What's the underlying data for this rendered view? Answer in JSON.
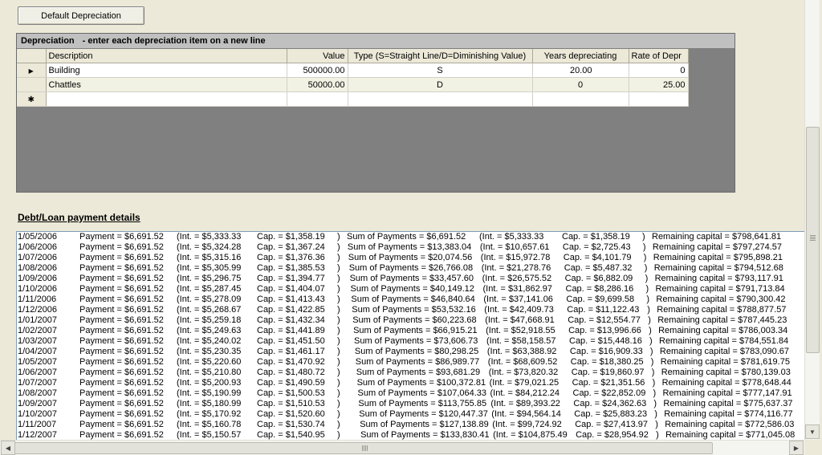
{
  "toolbar": {
    "default_depreciation_label": "Default Depreciation"
  },
  "depreciation": {
    "caption": "Depreciation",
    "hint": "- enter each depreciation item on a new line",
    "columns": [
      "Description",
      "Value",
      "Type (S=Straight  Line/D=Diminishing Value)",
      "Years depreciating",
      "Rate of Depr"
    ],
    "rows": [
      {
        "description": "Building",
        "value": "500000.00",
        "type": "S",
        "years": "20.00",
        "rate": "0"
      },
      {
        "description": "Chattles",
        "value": "50000.00",
        "type": "D",
        "years": "0",
        "rate": "25.00"
      }
    ],
    "current_row_glyph": "▶",
    "new_row_glyph": "✱"
  },
  "loan": {
    "title": "Debt/Loan payment details",
    "rows": [
      [
        "1/05/2006",
        "Payment = $6,691.52",
        "(Int. = $5,333.33",
        "Cap. = $1,358.19",
        ")",
        "Sum of Payments = $6,691.52",
        "(Int. = $5,333.33",
        "Cap. = $1,358.19",
        ")",
        "Remaining capital = $798,641.81"
      ],
      [
        "1/06/2006",
        "Payment = $6,691.52",
        "(Int. = $5,324.28",
        "Cap. = $1,367.24",
        ")",
        "Sum of Payments = $13,383.04",
        "(Int. = $10,657.61",
        "Cap. = $2,725.43",
        ")",
        "Remaining capital = $797,274.57"
      ],
      [
        "1/07/2006",
        "Payment = $6,691.52",
        "(Int. = $5,315.16",
        "Cap. = $1,376.36",
        ")",
        "Sum of Payments = $20,074.56",
        "(Int. = $15,972.78",
        "Cap. = $4,101.79",
        ")",
        "Remaining capital = $795,898.21"
      ],
      [
        "1/08/2006",
        "Payment = $6,691.52",
        "(Int. = $5,305.99",
        "Cap. = $1,385.53",
        ")",
        "Sum of Payments = $26,766.08",
        "(Int. = $21,278.76",
        "Cap. = $5,487.32",
        ")",
        "Remaining capital = $794,512.68"
      ],
      [
        "1/09/2006",
        "Payment = $6,691.52",
        "(Int. = $5,296.75",
        "Cap. = $1,394.77",
        ")",
        "Sum of Payments = $33,457.60",
        "(Int. = $26,575.52",
        "Cap. = $6,882.09",
        ")",
        "Remaining capital = $793,117.91"
      ],
      [
        "1/10/2006",
        "Payment = $6,691.52",
        "(Int. = $5,287.45",
        "Cap. = $1,404.07",
        ")",
        "Sum of Payments = $40,149.12",
        "(Int. = $31,862.97",
        "Cap. = $8,286.16",
        ")",
        "Remaining capital = $791,713.84"
      ],
      [
        "1/11/2006",
        "Payment = $6,691.52",
        "(Int. = $5,278.09",
        "Cap. = $1,413.43",
        ")",
        "Sum of Payments = $46,840.64",
        "(Int. = $37,141.06",
        "Cap. = $9,699.58",
        ")",
        "Remaining capital = $790,300.42"
      ],
      [
        "1/12/2006",
        "Payment = $6,691.52",
        "(Int. = $5,268.67",
        "Cap. = $1,422.85",
        ")",
        "Sum of Payments = $53,532.16",
        "(Int. = $42,409.73",
        "Cap. = $11,122.43",
        ")",
        "Remaining capital = $788,877.57"
      ],
      [
        "1/01/2007",
        "Payment = $6,691.52",
        "(Int. = $5,259.18",
        "Cap. = $1,432.34",
        ")",
        "Sum of Payments = $60,223.68",
        "(Int. = $47,668.91",
        "Cap. = $12,554.77",
        ")",
        "Remaining capital = $787,445.23"
      ],
      [
        "1/02/2007",
        "Payment = $6,691.52",
        "(Int. = $5,249.63",
        "Cap. = $1,441.89",
        ")",
        "Sum of Payments = $66,915.21",
        "(Int. = $52,918.55",
        "Cap. = $13,996.66",
        ")",
        "Remaining capital = $786,003.34"
      ],
      [
        "1/03/2007",
        "Payment = $6,691.52",
        "(Int. = $5,240.02",
        "Cap. = $1,451.50",
        ")",
        "Sum of Payments = $73,606.73",
        "(Int. = $58,158.57",
        "Cap. = $15,448.16",
        ")",
        "Remaining capital = $784,551.84"
      ],
      [
        "1/04/2007",
        "Payment = $6,691.52",
        "(Int. = $5,230.35",
        "Cap. = $1,461.17",
        ")",
        "Sum of Payments = $80,298.25",
        "(Int. = $63,388.92",
        "Cap. = $16,909.33",
        ")",
        "Remaining capital = $783,090.67"
      ],
      [
        "1/05/2007",
        "Payment = $6,691.52",
        "(Int. = $5,220.60",
        "Cap. = $1,470.92",
        ")",
        "Sum of Payments = $86,989.77",
        "(Int. = $68,609.52",
        "Cap. = $18,380.25",
        ")",
        "Remaining capital = $781,619.75"
      ],
      [
        "1/06/2007",
        "Payment = $6,691.52",
        "(Int. = $5,210.80",
        "Cap. = $1,480.72",
        ")",
        "Sum of Payments = $93,681.29",
        "(Int. = $73,820.32",
        "Cap. = $19,860.97",
        ")",
        "Remaining capital = $780,139.03"
      ],
      [
        "1/07/2007",
        "Payment = $6,691.52",
        "(Int. = $5,200.93",
        "Cap. = $1,490.59",
        ")",
        "Sum of Payments = $100,372.81",
        "(Int. = $79,021.25",
        "Cap. = $21,351.56",
        ")",
        "Remaining capital = $778,648.44"
      ],
      [
        "1/08/2007",
        "Payment = $6,691.52",
        "(Int. = $5,190.99",
        "Cap. = $1,500.53",
        ")",
        "Sum of Payments = $107,064.33",
        "(Int. = $84,212.24",
        "Cap. = $22,852.09",
        ")",
        "Remaining capital = $777,147.91"
      ],
      [
        "1/09/2007",
        "Payment = $6,691.52",
        "(Int. = $5,180.99",
        "Cap. = $1,510.53",
        ")",
        "Sum of Payments = $113,755.85",
        "(Int. = $89,393.22",
        "Cap. = $24,362.63",
        ")",
        "Remaining capital = $775,637.37"
      ],
      [
        "1/10/2007",
        "Payment = $6,691.52",
        "(Int. = $5,170.92",
        "Cap. = $1,520.60",
        ")",
        "Sum of Payments = $120,447.37",
        "(Int. = $94,564.14",
        "Cap. = $25,883.23",
        ")",
        "Remaining capital = $774,116.77"
      ],
      [
        "1/11/2007",
        "Payment = $6,691.52",
        "(Int. = $5,160.78",
        "Cap. = $1,530.74",
        ")",
        "Sum of Payments = $127,138.89",
        "(Int. = $99,724.92",
        "Cap. = $27,413.97",
        ")",
        "Remaining capital = $772,586.03"
      ],
      [
        "1/12/2007",
        "Payment = $6,691.52",
        "(Int. = $5,150.57",
        "Cap. = $1,540.95",
        ")",
        "Sum of Payments = $133,830.41",
        "(Int. = $104,875.49",
        "Cap. = $28,954.92",
        ")",
        "Remaining capital = $771,045.08"
      ]
    ]
  },
  "scroll": {
    "up_glyph": "▲",
    "down_glyph": "▼",
    "left_glyph": "◀",
    "right_glyph": "▶"
  }
}
